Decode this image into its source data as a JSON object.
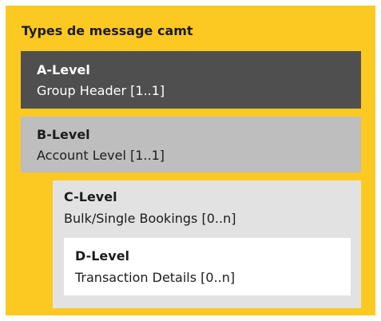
{
  "title": "Types de message camt",
  "levels": [
    {
      "level": "A-Level",
      "description": "Group Header [1..1]"
    },
    {
      "level": "B-Level",
      "description": "Account Level [1..1]"
    },
    {
      "level": "C-Level",
      "description": "Bulk/Single Bookings [0..n]"
    },
    {
      "level": "D-Level",
      "description": "Transaction Details [0..n]"
    }
  ],
  "colors": {
    "frame": "#fcc923",
    "a_level": "#4f4f4f",
    "b_level": "#bebebe",
    "c_level": "#e2e2e2",
    "d_level": "#ffffff"
  }
}
